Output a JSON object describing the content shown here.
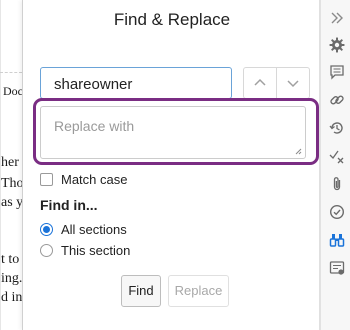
{
  "document": {
    "fragments": [
      "Doc",
      "her",
      "Tho",
      "as y",
      "t to",
      "ing.",
      "d in"
    ]
  },
  "panel": {
    "title": "Find & Replace",
    "find_value": "shareowner",
    "replace_placeholder": "Replace with",
    "match_case_label": "Match case",
    "match_case_checked": false,
    "find_in_heading": "Find in...",
    "scope_options": [
      {
        "label": "All sections",
        "selected": true
      },
      {
        "label": "This section",
        "selected": false
      }
    ],
    "find_button": "Find",
    "replace_button": "Replace",
    "replace_enabled": false
  },
  "rail": {
    "icons": [
      "collapse-icon",
      "settings-icon",
      "comment-icon",
      "link-icon",
      "history-icon",
      "track-changes-icon",
      "attachment-icon",
      "check-circle-icon",
      "find-replace-icon",
      "form-icon"
    ],
    "active_icon": "find-replace-icon",
    "active_color": "#1a73d9",
    "icon_color": "#6b6b6b"
  },
  "colors": {
    "highlight": "#7a2d83",
    "accent": "#1a73d9"
  }
}
